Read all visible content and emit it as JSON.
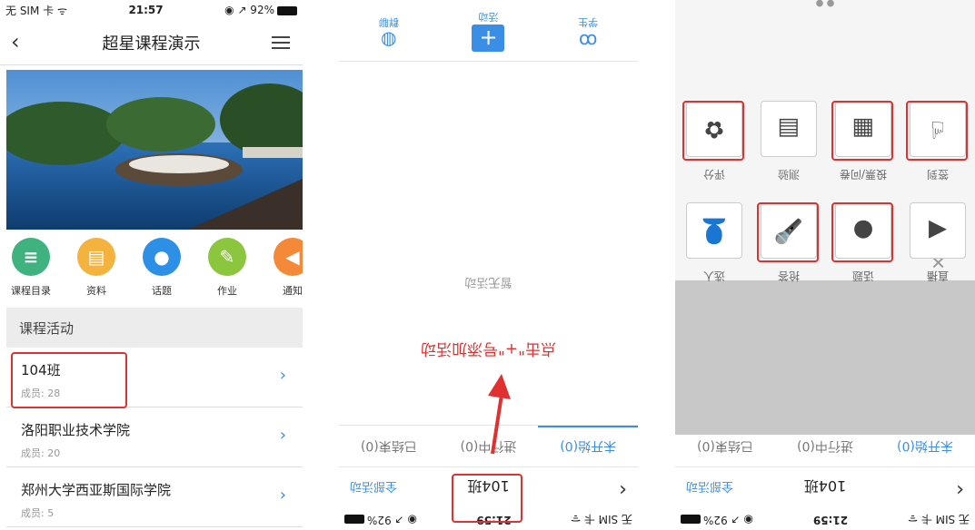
{
  "screen1": {
    "status": {
      "left": "无 SIM 卡 ᯤ",
      "time": "21:57",
      "right": "◉ ↗ 92%"
    },
    "title": "超星课程演示",
    "shortcuts": [
      {
        "label": "课程目录",
        "color": "#3fb27f",
        "icon": "list-icon",
        "glyph": "≡"
      },
      {
        "label": "资料",
        "color": "#f4b23e",
        "icon": "document-icon",
        "glyph": "▤"
      },
      {
        "label": "话题",
        "color": "#2d8fe6",
        "icon": "chat-icon",
        "glyph": "●"
      },
      {
        "label": "作业",
        "color": "#8cc63f",
        "icon": "edit-icon",
        "glyph": "✎"
      },
      {
        "label": "通知",
        "color": "#f5893a",
        "icon": "speaker-icon",
        "glyph": "◀"
      }
    ],
    "section_title": "课程活动",
    "courses": [
      {
        "name": "104班",
        "members": "成员: 28"
      },
      {
        "name": "洛阳职业技术学院",
        "members": "成员: 20"
      },
      {
        "name": "郑州大学西亚斯国际学院",
        "members": "成员: 5"
      }
    ]
  },
  "screen2": {
    "status": {
      "left": "无 SIM 卡 ᯤ",
      "time": "21:59",
      "right": "◉ ↗ 92%"
    },
    "title": "104班",
    "all_activities": "全部活动",
    "tabs": [
      "未开始(0)",
      "进行中(0)",
      "已结束(0)"
    ],
    "empty_text": "暂无活动",
    "instruction": "点击\"+\"号添加活动",
    "bottom": [
      {
        "label": "学生",
        "icon": "students-icon"
      },
      {
        "label": "活动",
        "icon": "plus-icon"
      },
      {
        "label": "群聊",
        "icon": "chat-icon"
      }
    ]
  },
  "screen3": {
    "status": {
      "left": "无 SIM 卡 ᯤ",
      "time": "21:59",
      "right": "◉ ↗ 92%"
    },
    "title": "104班",
    "all_activities": "全部活动",
    "tabs": [
      "未开始(0)",
      "进行中(0)",
      "已结束(0)"
    ],
    "actions": [
      {
        "label": "签到",
        "icon": "fingerprint-icon",
        "glyph": "☝"
      },
      {
        "label": "投票/问卷",
        "icon": "vote-icon",
        "glyph": "▦"
      },
      {
        "label": "测验",
        "icon": "quiz-icon",
        "glyph": "▤"
      },
      {
        "label": "评分",
        "icon": "flower-icon",
        "glyph": "✿"
      },
      {
        "label": "直播",
        "icon": "play-icon",
        "glyph": "◀"
      },
      {
        "label": "话题",
        "icon": "chat-icon",
        "glyph": "●"
      },
      {
        "label": "抢答",
        "icon": "microphone-icon",
        "glyph": "🎤"
      },
      {
        "label": "选人",
        "icon": "person-icon",
        "glyph": "👤"
      }
    ]
  }
}
